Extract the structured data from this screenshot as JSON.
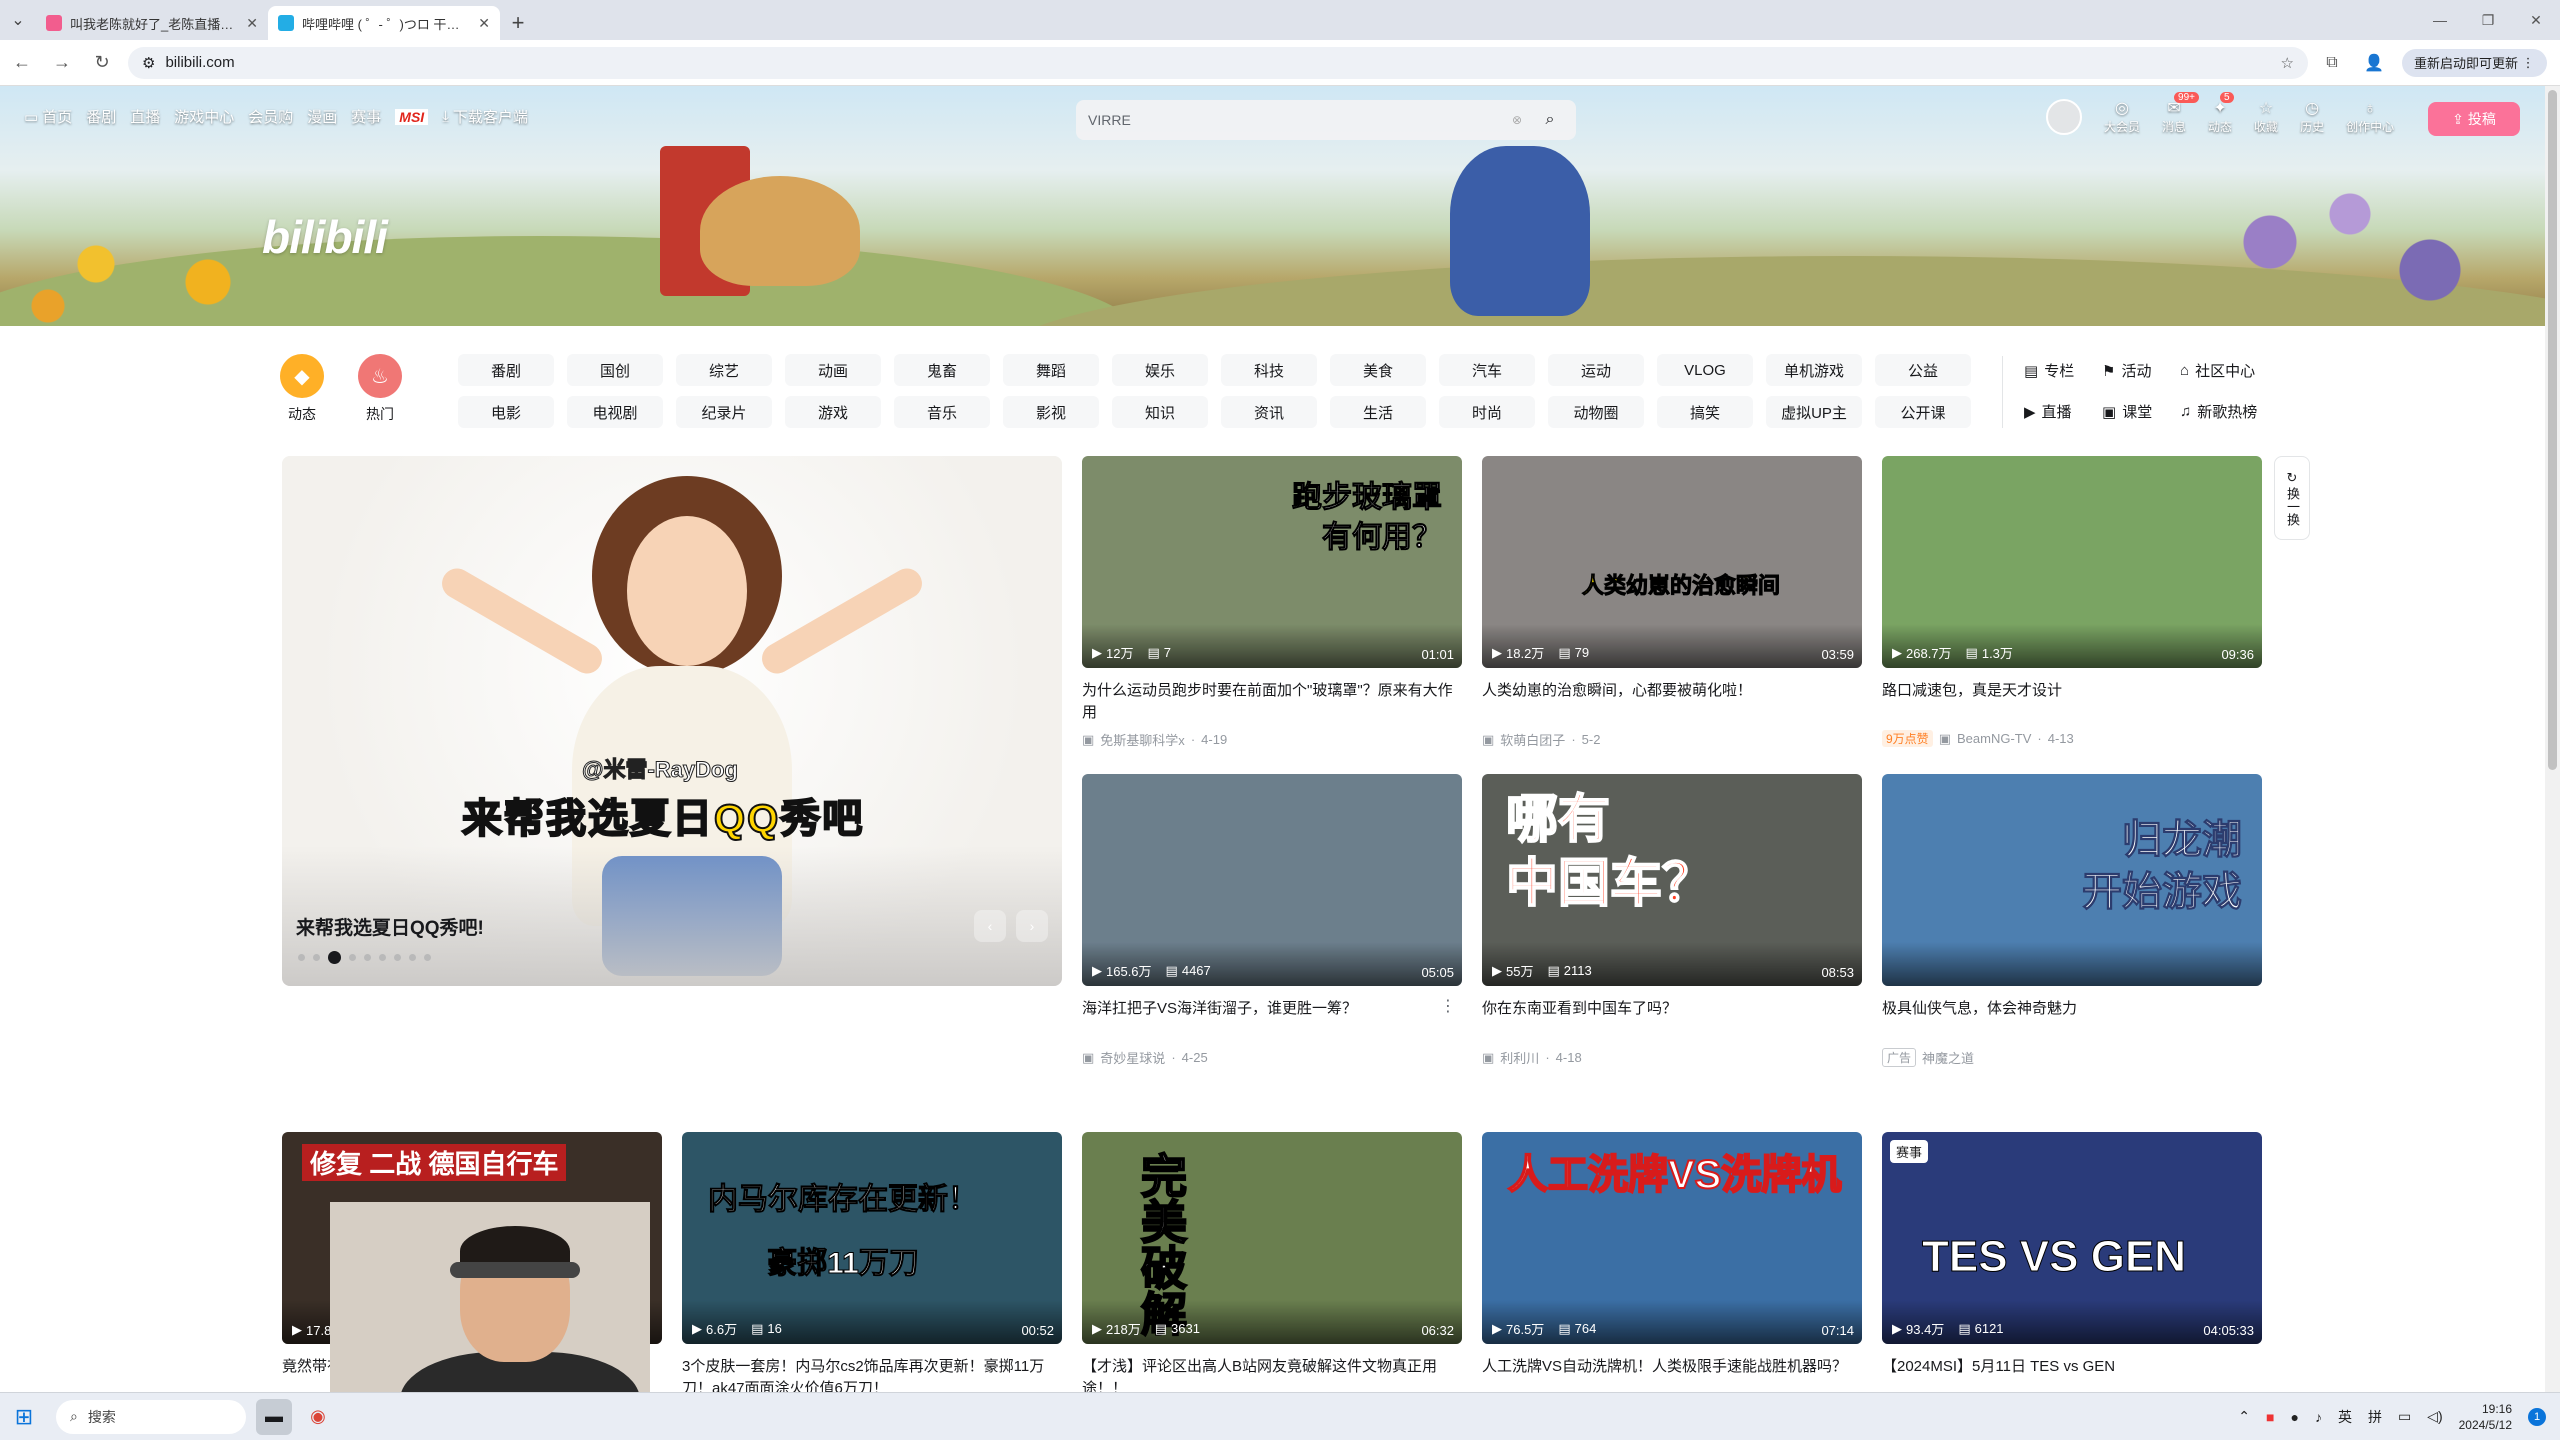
{
  "browser": {
    "tabs": [
      {
        "title": "叫我老陈就好了_老陈直播间74…",
        "active": false,
        "color": "#f25d8e"
      },
      {
        "title": "哔哩哔哩 ( ゜- ゜)つロ 干杯~-bi…",
        "active": true,
        "color": "#23ade5"
      }
    ],
    "url": "bilibili.com",
    "update_label": "重新启动即可更新"
  },
  "header": {
    "logo": "bilibili",
    "nav": [
      {
        "label": "首页",
        "icon": "tv-icon"
      },
      {
        "label": "番剧"
      },
      {
        "label": "直播"
      },
      {
        "label": "游戏中心"
      },
      {
        "label": "会员购"
      },
      {
        "label": "漫画"
      },
      {
        "label": "赛事"
      },
      {
        "label": "MSI",
        "special": true
      },
      {
        "label": "下载客户端",
        "icon": "download-icon"
      }
    ],
    "search_placeholder": "VIRRE",
    "right": [
      {
        "label": "大会员",
        "icon": "vip-icon"
      },
      {
        "label": "消息",
        "icon": "message-icon",
        "badge": "99+"
      },
      {
        "label": "动态",
        "icon": "dynamic-icon",
        "badge": "5"
      },
      {
        "label": "收藏",
        "icon": "star-icon"
      },
      {
        "label": "历史",
        "icon": "history-icon"
      },
      {
        "label": "创作中心",
        "icon": "bulb-icon"
      }
    ],
    "upload_label": "投稿"
  },
  "channels": {
    "left": [
      {
        "label": "动态",
        "icon": "dynamic-icon",
        "color": "#ffb027"
      },
      {
        "label": "热门",
        "icon": "fire-icon",
        "color": "#f07775"
      }
    ],
    "grid": [
      "番剧",
      "国创",
      "综艺",
      "动画",
      "鬼畜",
      "舞蹈",
      "娱乐",
      "科技",
      "美食",
      "汽车",
      "运动",
      "VLOG",
      "单机游戏",
      "公益",
      "电影",
      "电视剧",
      "纪录片",
      "游戏",
      "音乐",
      "影视",
      "知识",
      "资讯",
      "生活",
      "时尚",
      "动物圈",
      "搞笑",
      "虚拟UP主",
      "公开课"
    ],
    "right": [
      {
        "label": "专栏",
        "icon": "column-icon"
      },
      {
        "label": "活动",
        "icon": "flag-icon"
      },
      {
        "label": "社区中心",
        "icon": "community-icon"
      },
      {
        "label": "直播",
        "icon": "live-icon"
      },
      {
        "label": "课堂",
        "icon": "class-icon"
      },
      {
        "label": "新歌热榜",
        "icon": "music-icon"
      }
    ]
  },
  "carousel": {
    "handle": "@米雷-RayDog",
    "slogan_a": "来帮我选",
    "slogan_b": "夏日QQ秀吧",
    "caption": "来帮我选夏日QQ秀吧!",
    "slide_count": 9,
    "active_index": 2
  },
  "refresh_label": "换一换",
  "videos": [
    {
      "thumb_text": "跑步玻璃罩\n有何用？",
      "views": "12万",
      "comments": "7",
      "duration": "01:01",
      "title": "为什么运动员跑步时要在前面加个\"玻璃罩\"？原来有大作用",
      "author": "免斯基聊科学x",
      "date": "4-19",
      "bg": "#7d8c6a"
    },
    {
      "thumb_text": "人类幼崽的治愈瞬间",
      "views": "18.2万",
      "comments": "79",
      "duration": "03:59",
      "title": "人类幼崽的治愈瞬间，心都要被萌化啦！",
      "author": "软萌白团子",
      "date": "5-2",
      "bg": "#8a8684"
    },
    {
      "thumb_text": "",
      "views": "268.7万",
      "comments": "1.3万",
      "duration": "09:36",
      "title": "路口减速包，真是天才设计",
      "author": "BeamNG-TV",
      "date": "4-13",
      "tag": "9万点赞",
      "bg": "#7aa463"
    },
    {
      "thumb_text": "",
      "views": "165.6万",
      "comments": "4467",
      "duration": "05:05",
      "title": "海洋扛把子VS海洋街溜子，谁更胜一筹？",
      "author": "奇妙星球说",
      "date": "4-25",
      "bg": "#6c7f8c"
    },
    {
      "thumb_text": "哪有\n中国车？",
      "views": "55万",
      "comments": "2113",
      "duration": "08:53",
      "title": "你在东南亚看到中国车了吗？",
      "author": "利利川",
      "date": "4-18",
      "bg": "#5b5e58"
    },
    {
      "thumb_text": "归龙潮\n开始游戏",
      "views": "",
      "comments": "",
      "duration": "",
      "title": "极具仙侠气息，体会神奇魅力",
      "author": "神魔之道",
      "date": "",
      "ad": "广告",
      "bg": "#4d7fb0"
    },
    {
      "thumb_text": "修复 二战 德国自行车",
      "views": "17.8",
      "comments": "",
      "duration": "",
      "title": "竟然带有…二战时期…",
      "author": "",
      "date": "",
      "bg": "#3a2f27"
    },
    {
      "thumb_text": "内马尔库存在更新！\n豪掷11万刀",
      "views": "6.6万",
      "comments": "16",
      "duration": "00:52",
      "title": "3个皮肤一套房！内马尔cs2饰品库再次更新！豪掷11万刀！ak47面面涂火价值6万刀！",
      "author": "",
      "date": "",
      "bg": "#2d5566"
    },
    {
      "thumb_text": "完美破解",
      "views": "218万",
      "comments": "3631",
      "duration": "06:32",
      "title": "【才浅】评论区出高人B站网友竟破解这件文物真正用途！！",
      "author": "",
      "date": "",
      "bg": "#6a7f4f"
    },
    {
      "thumb_text": "人工洗牌VS洗牌机",
      "views": "76.5万",
      "comments": "764",
      "duration": "07:14",
      "title": "人工洗牌VS自动洗牌机！人类极限手速能战胜机器吗？",
      "author": "",
      "date": "",
      "bg": "#3b6fa5"
    },
    {
      "thumb_text": "TES VS GEN",
      "views": "93.4万",
      "comments": "6121",
      "duration": "04:05:33",
      "title": "【2024MSI】5月11日 TES vs GEN",
      "author": "",
      "date": "",
      "badge": "赛事",
      "bg": "#2a3b7a"
    }
  ],
  "taskbar": {
    "search_label": "搜索",
    "ime1": "英",
    "ime2": "拼",
    "time": "19:16",
    "date": "2024/5/12",
    "notif": "1"
  }
}
